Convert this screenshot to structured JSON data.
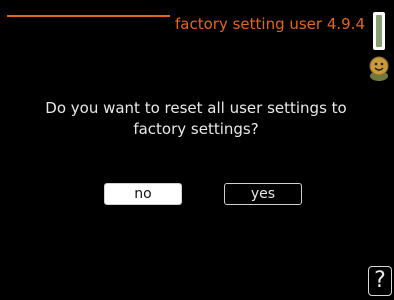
{
  "header": {
    "title": "factory setting user 4.9.4"
  },
  "dialog": {
    "question_line1": "Do you want to reset all user settings to",
    "question_line2": "factory settings?",
    "no_label": "no",
    "yes_label": "yes"
  },
  "help": {
    "label": "?"
  },
  "icons": {
    "scroll": "scroll-indicator",
    "avatar": "smiley-face-icon"
  },
  "colors": {
    "accent": "#e2661e",
    "background": "#000000",
    "text": "#e8e8e8"
  }
}
